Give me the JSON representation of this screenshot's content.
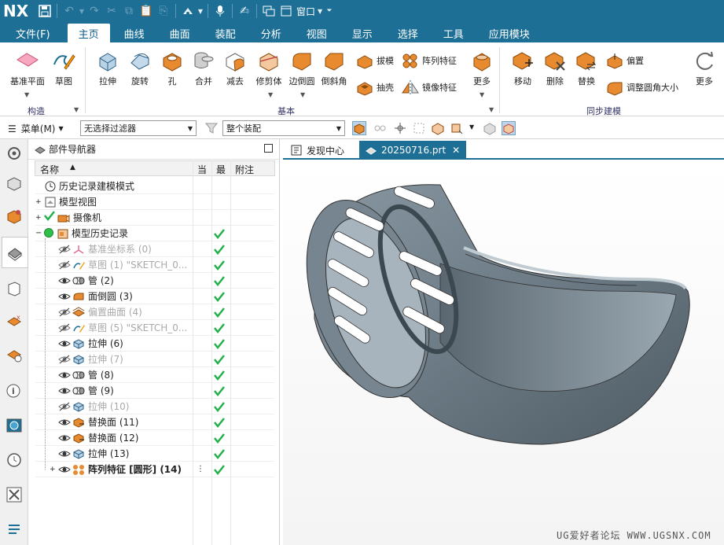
{
  "app": {
    "logo": "NX",
    "window_menu": "窗口",
    "colors": {
      "titlebar": "#1d6f96",
      "active_tab_text": "#0d5a85",
      "check": "#22b14c"
    }
  },
  "menu_tabs": [
    {
      "label": "文件(F)"
    },
    {
      "label": "主页",
      "active": true
    },
    {
      "label": "曲线"
    },
    {
      "label": "曲面"
    },
    {
      "label": "装配"
    },
    {
      "label": "分析"
    },
    {
      "label": "视图"
    },
    {
      "label": "显示"
    },
    {
      "label": "选择"
    },
    {
      "label": "工具"
    },
    {
      "label": "应用模块"
    }
  ],
  "ribbon": {
    "datum_plane": "基准平面",
    "sketch": "草图",
    "group_construct": "构造",
    "extrude": "拉伸",
    "revolve": "旋转",
    "hole": "孔",
    "unite": "合并",
    "subtract": "减去",
    "trim_body": "修剪体",
    "edge_blend": "边倒圆",
    "chamfer": "倒斜角",
    "draft": "拔模",
    "shell": "抽壳",
    "pattern_feature": "阵列特征",
    "mirror_feature": "镜像特征",
    "more1": "更多",
    "group_basic": "基本",
    "move": "移动",
    "delete": "删除",
    "replace": "替换",
    "offset": "偏置",
    "resize_blend": "调整圆角大小",
    "more2": "更多",
    "group_sync": "同步建模"
  },
  "toolbar": {
    "menu_label": "菜单(M)",
    "filter": "无选择过滤器",
    "scope": "整个装配"
  },
  "navigator": {
    "title": "部件导航器",
    "columns": {
      "name": "名称",
      "current": "当",
      "latest": "最",
      "note": "附注"
    },
    "rows": [
      {
        "label": "历史记录建模模式",
        "icon": "clock-icon",
        "grey": false,
        "check": false
      },
      {
        "label": "模型视图",
        "icon": "model-view-icon",
        "grey": false,
        "check": false
      },
      {
        "label": "摄像机",
        "icon": "camera-icon",
        "grey": false,
        "check": false
      },
      {
        "label": "模型历史记录",
        "icon": "history-folder-icon",
        "grey": false,
        "check": true
      },
      {
        "label": "基准坐标系 (0)",
        "icon": "datum-csys-icon",
        "grey": true,
        "check": true
      },
      {
        "label": "草图 (1) \"SKETCH_0...",
        "icon": "sketch-icon",
        "grey": true,
        "check": true
      },
      {
        "label": "管 (2)",
        "icon": "tube-icon",
        "grey": false,
        "check": true
      },
      {
        "label": "面倒圆 (3)",
        "icon": "face-blend-icon",
        "grey": false,
        "check": true
      },
      {
        "label": "偏置曲面 (4)",
        "icon": "offset-surface-icon",
        "grey": true,
        "check": true
      },
      {
        "label": "草图 (5) \"SKETCH_0...",
        "icon": "sketch-icon",
        "grey": true,
        "check": true
      },
      {
        "label": "拉伸 (6)",
        "icon": "extrude-icon",
        "grey": false,
        "check": true
      },
      {
        "label": "拉伸 (7)",
        "icon": "extrude-icon",
        "grey": true,
        "check": true
      },
      {
        "label": "管 (8)",
        "icon": "tube-icon",
        "grey": false,
        "check": true
      },
      {
        "label": "管 (9)",
        "icon": "tube-icon",
        "grey": false,
        "check": true
      },
      {
        "label": "拉伸 (10)",
        "icon": "extrude-icon",
        "grey": true,
        "check": true
      },
      {
        "label": "替换面 (11)",
        "icon": "replace-face-icon",
        "grey": false,
        "check": true
      },
      {
        "label": "替换面 (12)",
        "icon": "replace-face-icon",
        "grey": false,
        "check": true
      },
      {
        "label": "拉伸 (13)",
        "icon": "extrude-icon",
        "grey": false,
        "check": true
      },
      {
        "label": "阵列特征 [圆形] (14)",
        "icon": "pattern-icon",
        "grey": false,
        "check": true,
        "bold": true
      }
    ]
  },
  "graphics_tabs": [
    {
      "label": "发现中心"
    },
    {
      "label": "20250716.prt",
      "active": true
    }
  ],
  "watermark": "UG爱好者论坛 WWW.UGSNX.COM"
}
